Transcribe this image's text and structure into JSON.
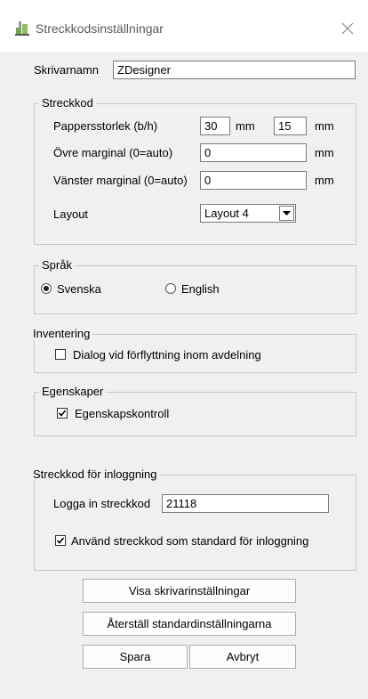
{
  "window": {
    "title": "Streckkodsinställningar"
  },
  "printer": {
    "label": "Skrivarnamn",
    "value": "ZDesigner"
  },
  "barcode": {
    "legend": "Streckkod",
    "paper_size_label": "Pappersstorlek (b/h)",
    "width_value": "30",
    "height_value": "15",
    "unit": "mm",
    "top_margin_label": "Övre marginal (0=auto)",
    "top_margin_value": "0",
    "left_margin_label": "Vänster marginal (0=auto)",
    "left_margin_value": "0",
    "layout_label": "Layout",
    "layout_value": "Layout 4"
  },
  "language": {
    "legend": "Språk",
    "options": [
      {
        "label": "Svenska",
        "selected": true
      },
      {
        "label": "English",
        "selected": false
      }
    ]
  },
  "inventory": {
    "legend": "Inventering",
    "checkbox_label": "Dialog vid förflyttning inom avdelning",
    "checked": false
  },
  "properties": {
    "legend": "Egenskaper",
    "checkbox_label": "Egenskapskontroll",
    "checked": true
  },
  "login": {
    "legend": "Streckkod för inloggning",
    "label": "Logga in streckkod",
    "value": "21118",
    "checkbox_label": "Använd streckkod som standard för inloggning",
    "checked": true
  },
  "buttons": {
    "show_printer_settings": "Visa skrivarinställningar",
    "reset_defaults": "Återställ standardinställningarna",
    "save": "Spara",
    "cancel": "Avbryt"
  }
}
